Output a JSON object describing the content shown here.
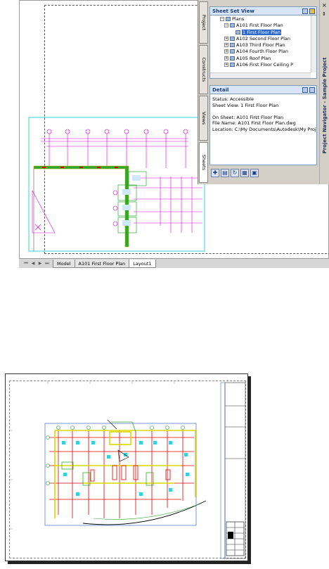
{
  "palette": {
    "title": "Project Navigator - Sample Project",
    "vertical_tabs": [
      "Project",
      "Constructs",
      "Views",
      "Sheets"
    ],
    "active_tab": "Sheets",
    "sheet_set_view": {
      "title": "Sheet Set View",
      "tree": [
        {
          "label": "Plans",
          "level": 0,
          "expander": "minus"
        },
        {
          "label": "A101 First Floor Plan",
          "level": 1,
          "expander": "minus"
        },
        {
          "label": "1 First Floor Plan",
          "level": 2,
          "expander": "",
          "selected": true
        },
        {
          "label": "A102 Second Floor Plan",
          "level": 1,
          "expander": "plus"
        },
        {
          "label": "A103 Third Floor Plan",
          "level": 1,
          "expander": "plus"
        },
        {
          "label": "A104 Fourth Floor Plan",
          "level": 1,
          "expander": "plus"
        },
        {
          "label": "A105 Roof Plan",
          "level": 1,
          "expander": "plus"
        },
        {
          "label": "A106 First Floor Ceiling P",
          "level": 1,
          "expander": "plus"
        }
      ]
    },
    "detail": {
      "title": "Detail",
      "lines": [
        "Status: Accessible",
        "Sheet View: 1 First Floor Plan",
        "",
        "On Sheet: A101 First Floor Plan",
        "File Name: A101 First Floor Plan.dwg",
        "Location: C:\\My Documents\\Autodesk\\My Proje"
      ]
    },
    "toolbar_icons": [
      "add-view-icon",
      "publish-icon",
      "regenerate-icon",
      "sheet-list-icon",
      "properties-icon"
    ]
  },
  "layout_tabs": {
    "tabs": [
      "Model",
      "A101 First Floor Plan",
      "Layout1"
    ],
    "active": "Layout1"
  },
  "colors": {
    "magenta": "#e000e0",
    "cyan": "#00c8d8",
    "green": "#2ea82e",
    "red": "#e00000",
    "yellow": "#d8d800",
    "blue": "#2050c0"
  }
}
